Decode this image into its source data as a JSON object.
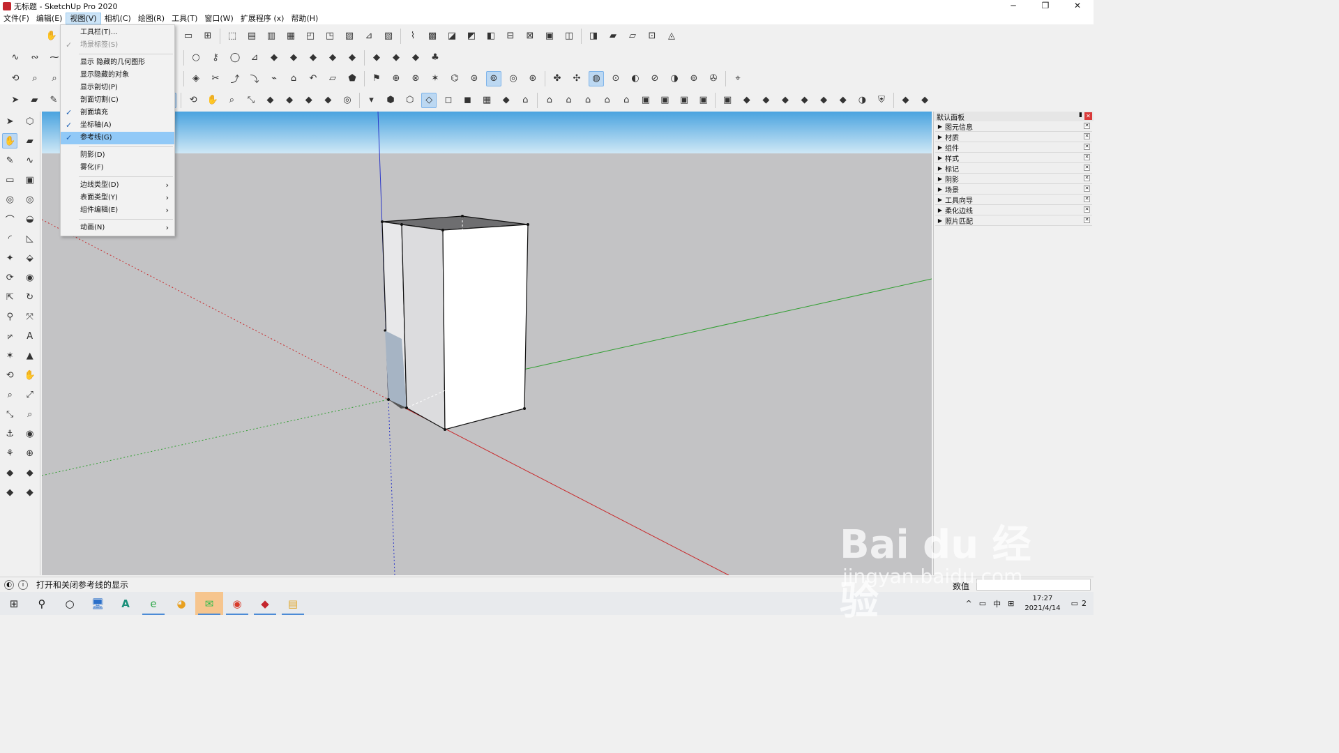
{
  "window": {
    "title": "无标题 - SketchUp Pro 2020",
    "controls": [
      "─",
      "❐",
      "✕"
    ]
  },
  "menubar": {
    "items": [
      "文件(F)",
      "编辑(E)",
      "视图(V)",
      "相机(C)",
      "绘图(R)",
      "工具(T)",
      "窗口(W)",
      "扩展程序 (x)",
      "帮助(H)"
    ],
    "active_index": 2
  },
  "view_menu": {
    "items": [
      {
        "label": "工具栏(T)...",
        "checked": false,
        "disabled": false,
        "submenu": false
      },
      {
        "label": "场景标签(S)",
        "checked": true,
        "disabled": true,
        "submenu": false
      },
      {
        "sep": true
      },
      {
        "label": "显示 隐藏的几何图形",
        "checked": false,
        "disabled": false,
        "submenu": false
      },
      {
        "label": "显示隐藏的对象",
        "checked": false,
        "disabled": false,
        "submenu": false
      },
      {
        "label": "显示剖切(P)",
        "checked": false,
        "disabled": false,
        "submenu": false
      },
      {
        "label": "剖面切割(C)",
        "checked": false,
        "disabled": false,
        "submenu": false
      },
      {
        "label": "剖面填充",
        "checked": true,
        "disabled": false,
        "submenu": false
      },
      {
        "label": "坐标轴(A)",
        "checked": true,
        "disabled": false,
        "submenu": false
      },
      {
        "label": "参考线(G)",
        "checked": true,
        "disabled": false,
        "submenu": false,
        "highlighted": true
      },
      {
        "sep": true
      },
      {
        "label": "阴影(D)",
        "checked": false,
        "disabled": false,
        "submenu": false
      },
      {
        "label": "雾化(F)",
        "checked": false,
        "disabled": false,
        "submenu": false
      },
      {
        "sep": true
      },
      {
        "label": "边线类型(D)",
        "checked": false,
        "disabled": false,
        "submenu": true
      },
      {
        "label": "表面类型(Y)",
        "checked": false,
        "disabled": false,
        "submenu": true
      },
      {
        "label": "组件编辑(E)",
        "checked": false,
        "disabled": false,
        "submenu": true
      },
      {
        "sep": true
      },
      {
        "label": "动画(N)",
        "checked": false,
        "disabled": false,
        "submenu": true
      }
    ]
  },
  "tray_panel": {
    "title": "默认面板",
    "sections": [
      "图元信息",
      "材质",
      "组件",
      "样式",
      "标记",
      "阴影",
      "场景",
      "工具向导",
      "柔化边线",
      "照片匹配"
    ]
  },
  "statusbar": {
    "hint": "打开和关闭参考线的显示",
    "vcb_label": "数值",
    "vcb_value": ""
  },
  "taskbar": {
    "time": "17:27",
    "date": "2021/4/14",
    "ime": "中",
    "notification_count": "2"
  },
  "watermark": {
    "main": "Bai du 经验",
    "sub": "jingyan.baidu.com"
  },
  "colors": {
    "sky_top": "#4aa3df",
    "sky_bottom": "#cfe8f6",
    "ground": "#c3c3c5",
    "axis_red": "#c8282a",
    "axis_green": "#2e9e2e",
    "axis_blue": "#2a36c8",
    "menu_highlight": "#91c9f7"
  }
}
